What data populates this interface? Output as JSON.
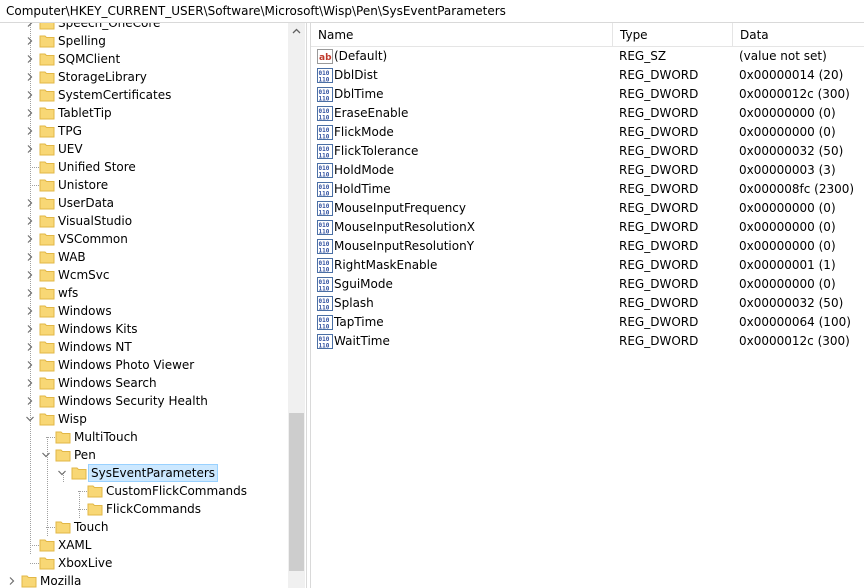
{
  "address": {
    "path": "Computer\\HKEY_CURRENT_USER\\Software\\Microsoft\\Wisp\\Pen\\SysEventParameters"
  },
  "tree": {
    "items": [
      {
        "label": "Speech_OneCore",
        "level": 0,
        "expander": "collapsed"
      },
      {
        "label": "Spelling",
        "level": 0,
        "expander": "collapsed"
      },
      {
        "label": "SQMClient",
        "level": 0,
        "expander": "collapsed"
      },
      {
        "label": "StorageLibrary",
        "level": 0,
        "expander": "collapsed"
      },
      {
        "label": "SystemCertificates",
        "level": 0,
        "expander": "collapsed"
      },
      {
        "label": "TabletTip",
        "level": 0,
        "expander": "collapsed"
      },
      {
        "label": "TPG",
        "level": 0,
        "expander": "collapsed"
      },
      {
        "label": "UEV",
        "level": 0,
        "expander": "collapsed"
      },
      {
        "label": "Unified Store",
        "level": 0,
        "expander": "none"
      },
      {
        "label": "Unistore",
        "level": 0,
        "expander": "none"
      },
      {
        "label": "UserData",
        "level": 0,
        "expander": "collapsed"
      },
      {
        "label": "VisualStudio",
        "level": 0,
        "expander": "collapsed"
      },
      {
        "label": "VSCommon",
        "level": 0,
        "expander": "collapsed"
      },
      {
        "label": "WAB",
        "level": 0,
        "expander": "collapsed"
      },
      {
        "label": "WcmSvc",
        "level": 0,
        "expander": "collapsed"
      },
      {
        "label": "wfs",
        "level": 0,
        "expander": "collapsed"
      },
      {
        "label": "Windows",
        "level": 0,
        "expander": "collapsed"
      },
      {
        "label": "Windows Kits",
        "level": 0,
        "expander": "collapsed"
      },
      {
        "label": "Windows NT",
        "level": 0,
        "expander": "collapsed"
      },
      {
        "label": "Windows Photo Viewer",
        "level": 0,
        "expander": "collapsed"
      },
      {
        "label": "Windows Search",
        "level": 0,
        "expander": "collapsed"
      },
      {
        "label": "Windows Security Health",
        "level": 0,
        "expander": "collapsed"
      },
      {
        "label": "Wisp",
        "level": 0,
        "expander": "expanded"
      },
      {
        "label": "MultiTouch",
        "level": 1,
        "expander": "none"
      },
      {
        "label": "Pen",
        "level": 1,
        "expander": "expanded"
      },
      {
        "label": "SysEventParameters",
        "level": 2,
        "expander": "expanded",
        "selected": true
      },
      {
        "label": "CustomFlickCommands",
        "level": 3,
        "expander": "none"
      },
      {
        "label": "FlickCommands",
        "level": 3,
        "expander": "none"
      },
      {
        "label": "Touch",
        "level": 1,
        "expander": "none"
      },
      {
        "label": "XAML",
        "level": 0,
        "expander": "none"
      },
      {
        "label": "XboxLive",
        "level": 0,
        "expander": "none"
      },
      {
        "label": "Mozilla",
        "level": -1,
        "expander": "collapsed"
      }
    ]
  },
  "list": {
    "headers": {
      "name": "Name",
      "type": "Type",
      "data": "Data"
    },
    "rows": [
      {
        "icon": "string-value-icon",
        "name": "(Default)",
        "type": "REG_SZ",
        "data": "(value not set)"
      },
      {
        "icon": "binary-value-icon",
        "name": "DblDist",
        "type": "REG_DWORD",
        "data": "0x00000014 (20)"
      },
      {
        "icon": "binary-value-icon",
        "name": "DblTime",
        "type": "REG_DWORD",
        "data": "0x0000012c (300)"
      },
      {
        "icon": "binary-value-icon",
        "name": "EraseEnable",
        "type": "REG_DWORD",
        "data": "0x00000000 (0)"
      },
      {
        "icon": "binary-value-icon",
        "name": "FlickMode",
        "type": "REG_DWORD",
        "data": "0x00000000 (0)"
      },
      {
        "icon": "binary-value-icon",
        "name": "FlickTolerance",
        "type": "REG_DWORD",
        "data": "0x00000032 (50)"
      },
      {
        "icon": "binary-value-icon",
        "name": "HoldMode",
        "type": "REG_DWORD",
        "data": "0x00000003 (3)"
      },
      {
        "icon": "binary-value-icon",
        "name": "HoldTime",
        "type": "REG_DWORD",
        "data": "0x000008fc (2300)"
      },
      {
        "icon": "binary-value-icon",
        "name": "MouseInputFrequency",
        "type": "REG_DWORD",
        "data": "0x00000000 (0)"
      },
      {
        "icon": "binary-value-icon",
        "name": "MouseInputResolutionX",
        "type": "REG_DWORD",
        "data": "0x00000000 (0)"
      },
      {
        "icon": "binary-value-icon",
        "name": "MouseInputResolutionY",
        "type": "REG_DWORD",
        "data": "0x00000000 (0)"
      },
      {
        "icon": "binary-value-icon",
        "name": "RightMaskEnable",
        "type": "REG_DWORD",
        "data": "0x00000001 (1)"
      },
      {
        "icon": "binary-value-icon",
        "name": "SguiMode",
        "type": "REG_DWORD",
        "data": "0x00000000 (0)"
      },
      {
        "icon": "binary-value-icon",
        "name": "Splash",
        "type": "REG_DWORD",
        "data": "0x00000032 (50)"
      },
      {
        "icon": "binary-value-icon",
        "name": "TapTime",
        "type": "REG_DWORD",
        "data": "0x00000064 (100)"
      },
      {
        "icon": "binary-value-icon",
        "name": "WaitTime",
        "type": "REG_DWORD",
        "data": "0x0000012c (300)"
      }
    ]
  },
  "colors": {
    "folder": "#f8d775",
    "folder_dark": "#e2b746",
    "selection_bg": "#cce8ff",
    "selection_border": "#99d1ff",
    "chevron": "#6d6d6d"
  }
}
